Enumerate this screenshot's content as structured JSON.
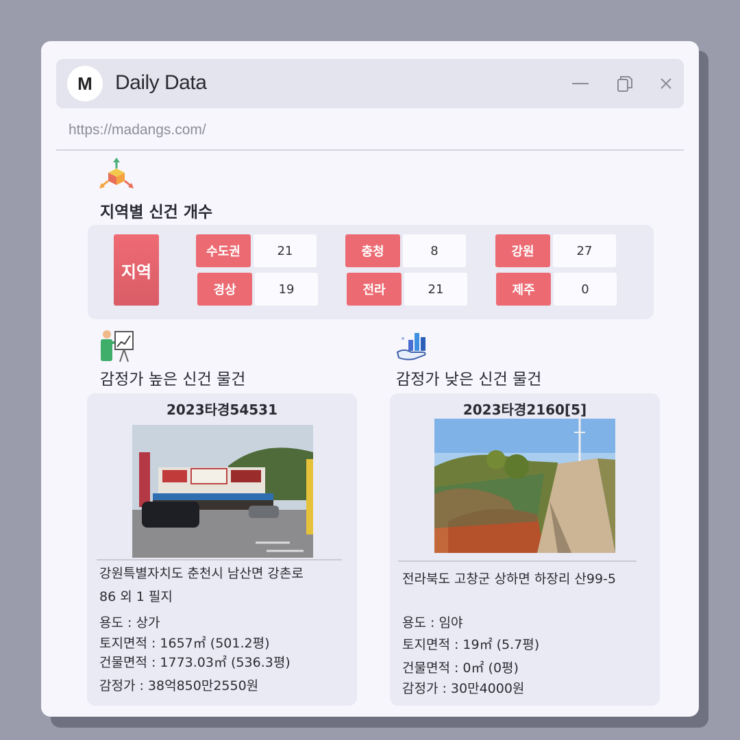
{
  "window": {
    "logo_letter": "M",
    "title": "Daily Data",
    "url": "https://madangs.com/"
  },
  "region_section": {
    "title": "지역별 신건 개수",
    "main_label": "지역",
    "regions": [
      {
        "name": "수도권",
        "count": "21"
      },
      {
        "name": "충청",
        "count": "8"
      },
      {
        "name": "강원",
        "count": "27"
      },
      {
        "name": "경상",
        "count": "19"
      },
      {
        "name": "전라",
        "count": "21"
      },
      {
        "name": "제주",
        "count": "0"
      }
    ]
  },
  "high": {
    "title": "감정가 높은 신건 물건",
    "case_no": "2023타경54531",
    "address_line1": "강원특별자치도 춘천시 남산면 강촌로",
    "address_line2": "86 외 1 필지",
    "usage": "용도 : 상가",
    "land_area": "토지면적 : 1657㎡ (501.2평)",
    "building_area": "건물면적 : 1773.03㎡ (536.3평)",
    "appraisal": "감정가 : 38억850만2550원"
  },
  "low": {
    "title": "감정가 낮은 신건 물건",
    "case_no": "2023타경2160[5]",
    "address_line1": "전라북도 고창군 상하면 하장리 산99-5",
    "usage": "용도 :  임야",
    "land_area": "토지면적 : 19㎡ (5.7평)",
    "building_area": "건물면적 : 0㎡ (0평)",
    "appraisal": "감정가 : 30만4000원"
  },
  "colors": {
    "accent_red": "#ec6b73",
    "panel": "#eaeaf5",
    "background": "#9a9bab"
  },
  "icons": [
    "minimize-icon",
    "restore-icon",
    "close-icon",
    "cube-arrows-icon",
    "presentation-chart-icon",
    "hand-chart-icon"
  ]
}
